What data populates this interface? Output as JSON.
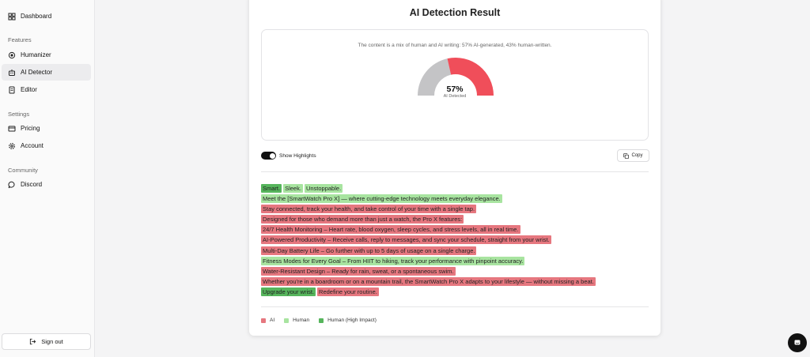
{
  "sidebar": {
    "dashboard": "Dashboard",
    "features_label": "Features",
    "humanizer": "Humanizer",
    "ai_detector": "AI Detector",
    "editor": "Editor",
    "settings_label": "Settings",
    "pricing": "Pricing",
    "account": "Account",
    "community_label": "Community",
    "discord": "Discord",
    "sign_out": "Sign out"
  },
  "result": {
    "title": "AI Detection Result",
    "summary": "The content is a mix of human and AI writing: 57% AI-generated, 43% human-written.",
    "percent": 57,
    "percent_label": "57%",
    "gauge_caption": "AI Detected",
    "ai_color": "#f04e5a",
    "human_color": "#c4c4c6"
  },
  "controls": {
    "show_highlights": "Show Highlights",
    "show_highlights_on": true,
    "copy": "Copy"
  },
  "lines": [
    [
      {
        "text": "Smart.",
        "kind": "hi"
      },
      {
        "text": "Sleek.",
        "kind": "human"
      },
      {
        "text": "Unstoppable.",
        "kind": "human"
      }
    ],
    [
      {
        "text": "Meet the [SmartWatch Pro X] — where cutting-edge technology meets everyday elegance.",
        "kind": "human"
      }
    ],
    [
      {
        "text": "Stay connected, track your health, and take control of your time with a single tap.",
        "kind": "ai"
      }
    ],
    [
      {
        "text": "Designed for those who demand more than just a watch, the Pro X features:",
        "kind": "ai"
      }
    ],
    [
      {
        "text": "24/7 Health Monitoring – Heart rate, blood oxygen, sleep cycles, and stress levels, all in real time.",
        "kind": "ai"
      }
    ],
    [
      {
        "text": "AI-Powered Productivity – Receive calls, reply to messages, and sync your schedule, straight from your wrist.",
        "kind": "ai"
      }
    ],
    [
      {
        "text": "Multi-Day Battery Life – Go further with up to 5 days of usage on a single charge.",
        "kind": "ai"
      }
    ],
    [
      {
        "text": "Fitness Modes for Every Goal – From HIIT to hiking, track your performance with pinpoint accuracy.",
        "kind": "human"
      }
    ],
    [
      {
        "text": "Water-Resistant Design – Ready for rain, sweat, or a spontaneous swim.",
        "kind": "ai"
      }
    ],
    [
      {
        "text": "Whether you're in a boardroom or on a mountain trail, the SmartWatch Pro X adapts to your lifestyle — without missing a beat.",
        "kind": "ai"
      }
    ],
    [
      {
        "text": "Upgrade your wrist.",
        "kind": "hi"
      },
      {
        "text": "Redefine your routine.",
        "kind": "ai"
      }
    ]
  ],
  "legend": {
    "ai": "AI",
    "human": "Human",
    "human_high": "Human (High Impact)"
  },
  "icons": {
    "dashboard": "grid-icon",
    "humanizer": "sparkle-icon",
    "ai_detector": "robot-icon",
    "editor": "document-icon",
    "pricing": "credit-card-icon",
    "account": "gear-icon",
    "discord": "chat-bubble-icon",
    "sign_out": "sign-out-icon",
    "copy": "copy-icon",
    "support": "chat-icon"
  }
}
